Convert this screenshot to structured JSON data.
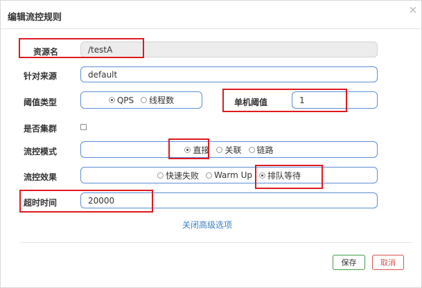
{
  "dialog": {
    "title": "编辑流控规则",
    "close_symbol": "×"
  },
  "form": {
    "resource_name": {
      "label": "资源名",
      "value": "/testA"
    },
    "limit_app": {
      "label": "针对来源",
      "value": "default"
    },
    "threshold_type": {
      "label": "阈值类型",
      "options": [
        "QPS",
        "线程数"
      ],
      "selected": "QPS"
    },
    "single_threshold": {
      "label": "单机阈值",
      "value": "1"
    },
    "cluster": {
      "label": "是否集群",
      "checked": false
    },
    "flow_mode": {
      "label": "流控模式",
      "options": [
        "直接",
        "关联",
        "链路"
      ],
      "selected": "直接"
    },
    "flow_effect": {
      "label": "流控效果",
      "options": [
        "快速失败",
        "Warm Up",
        "排队等待"
      ],
      "selected": "排队等待"
    },
    "timeout": {
      "label": "超时时间",
      "value": "20000"
    },
    "advanced_link": "关闭高级选项"
  },
  "footer": {
    "save_label": "保存",
    "cancel_label": "取消"
  },
  "colors": {
    "annotation_red": "#e0181f",
    "input_border": "#5b8dd6",
    "link": "#3b7fc4",
    "save_border": "#3f9a3f",
    "cancel": "#d9534f"
  }
}
